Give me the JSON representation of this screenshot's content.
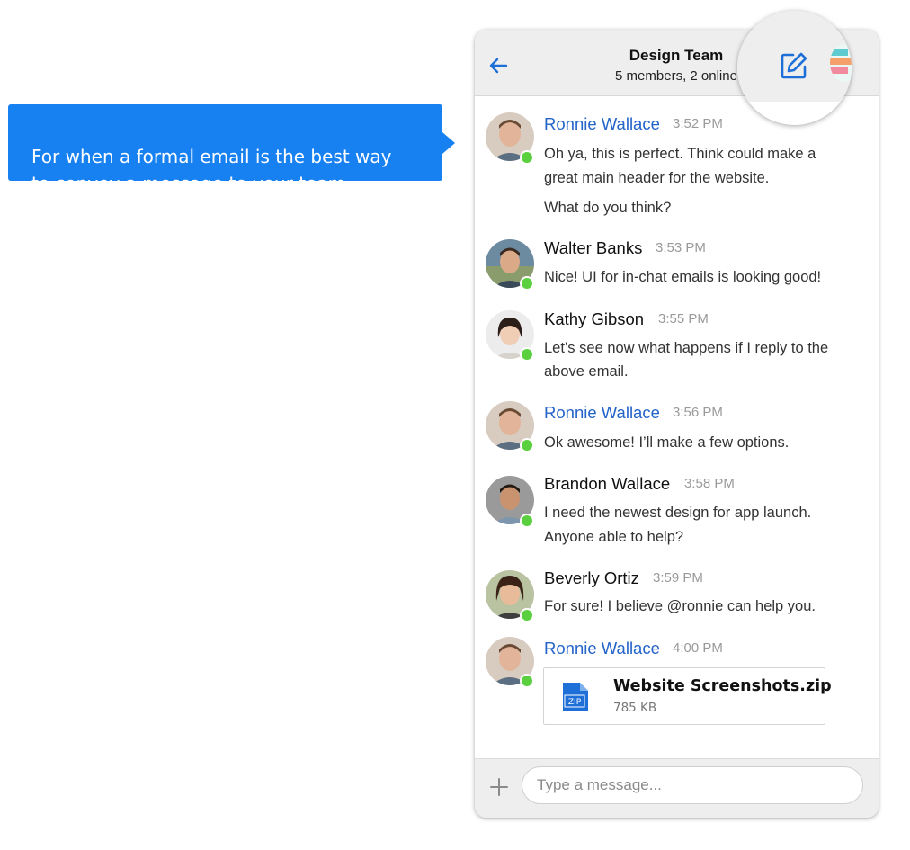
{
  "tooltip": {
    "text": "For when a formal email is the best way\nto convey a message to your team."
  },
  "header": {
    "title": "Design Team",
    "subtitle": "5 members,  2 online"
  },
  "messages": [
    {
      "name": "Ronnie Wallace",
      "time": "3:52 PM",
      "highlight": true,
      "lines": [
        "Oh ya, this is perfect. Think could make a",
        "great main header for the website.",
        "What do you think?"
      ]
    },
    {
      "name": "Walter Banks",
      "time": "3:53 PM",
      "highlight": false,
      "lines": [
        "Nice! UI for in-chat emails is looking good!"
      ]
    },
    {
      "name": "Kathy Gibson",
      "time": "3:55 PM",
      "highlight": false,
      "lines": [
        "Let’s see now what happens if I reply to the",
        "above email."
      ]
    },
    {
      "name": "Ronnie Wallace",
      "time": "3:56 PM",
      "highlight": true,
      "lines": [
        "Ok awesome! I’ll make a few options."
      ]
    },
    {
      "name": "Brandon Wallace",
      "time": "3:58 PM",
      "highlight": false,
      "lines": [
        "I need the newest design for app launch.",
        "Anyone able to help?"
      ]
    },
    {
      "name": "Beverly Ortiz",
      "time": "3:59 PM",
      "highlight": false,
      "lines": [
        "For sure! I believe @ronnie can help you."
      ]
    },
    {
      "name": "Ronnie Wallace",
      "time": "4:00 PM",
      "highlight": true,
      "lines": []
    }
  ],
  "attachment": {
    "name": "Website Screenshots.zip",
    "size": "785 KB",
    "icon": "zip-file-icon",
    "badge": "ZIP"
  },
  "composer": {
    "placeholder": "Type a message..."
  },
  "icons": {
    "back": "back-arrow-icon",
    "compose": "compose-edit-icon",
    "add": "plus-icon"
  },
  "colors": {
    "accent": "#1781f2",
    "name_highlight": "#2464c9",
    "online": "#5bd03f",
    "icon_blue": "#1f6fd9"
  }
}
